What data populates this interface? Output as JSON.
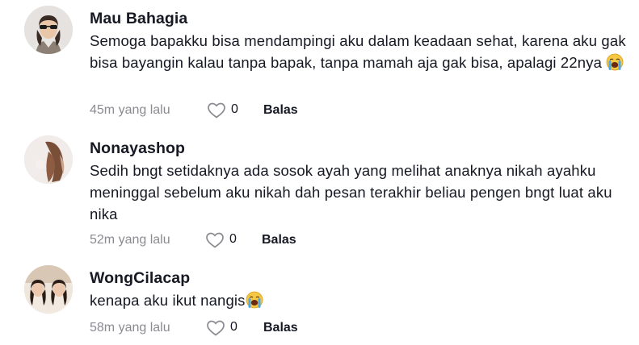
{
  "comments": [
    {
      "username": "Mau Bahagia",
      "text": "Semoga bapakku bisa mendampingi aku dalam keadaan sehat, karena aku gak bisa bayangin kalau tanpa bapak, tanpa mamah aja gak bisa, apalagi 22nya",
      "emoji": "loudly-crying-face-icon",
      "time": "45m yang lalu",
      "likes": "0",
      "reply_label": "Balas"
    },
    {
      "username": "Nonayashop",
      "text": "Sedih bngt setidaknya ada sosok ayah yang melihat anaknya nikah ayahku meninggal sebelum aku nikah dah pesan terakhir beliau pengen bngt luat aku nika",
      "time": "52m yang lalu",
      "likes": "0",
      "reply_label": "Balas"
    },
    {
      "username": "WongCilacap",
      "text": "kenapa aku ikut nangis",
      "emoji": "loudly-crying-face-icon",
      "time": "58m yang lalu",
      "likes": "0",
      "reply_label": "Balas"
    }
  ],
  "colors": {
    "primary_text": "#161823",
    "secondary_text": "#8a8b91"
  }
}
